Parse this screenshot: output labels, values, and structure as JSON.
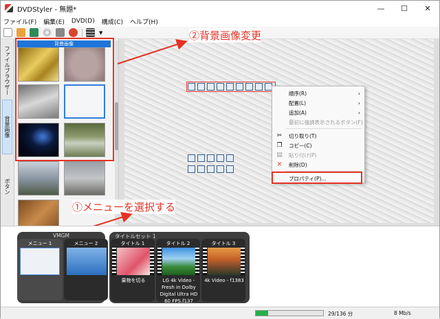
{
  "window": {
    "title": "DVDStyler - 無題*",
    "minimize": "—",
    "maximize": "☐",
    "close": "✕"
  },
  "menubar": [
    "ファイル(F)",
    "編集(E)",
    "DVD(D)",
    "構成(C)",
    "ヘルプ(H)"
  ],
  "side_tabs": [
    "ファイルブラウザー",
    "背景画像",
    "ボタン"
  ],
  "panel": {
    "header": "背景画像"
  },
  "canvas": {
    "button_row_1_count": 9,
    "button_row_2_count": 5,
    "button_row_3_count": 5
  },
  "context_menu": {
    "items": [
      {
        "label": "順序(R)",
        "submenu": true,
        "disabled": false
      },
      {
        "label": "配置(L)",
        "submenu": true,
        "disabled": false
      },
      {
        "label": "追加(A)",
        "submenu": true,
        "disabled": false
      },
      {
        "label": "最初に強調表示されるボタン(F)",
        "submenu": false,
        "disabled": true
      },
      {
        "label": "切り取り(T)",
        "icon": "cut-icon",
        "disabled": false
      },
      {
        "label": "コピー(C)",
        "icon": "copy-icon",
        "disabled": false
      },
      {
        "label": "貼り付け(P)",
        "icon": "paste-icon",
        "disabled": true
      },
      {
        "label": "削除(D)",
        "icon": "delete-icon",
        "disabled": false
      },
      {
        "label": "プロパティ(P)...",
        "disabled": false
      }
    ]
  },
  "annotations": {
    "step1": "①メニューを選択する",
    "step2": "②背景画像変更",
    "color": "#e53224"
  },
  "bottom": {
    "vmgm": {
      "label": "VMGM",
      "items": [
        {
          "label": "メニュー 1"
        },
        {
          "label": "メニュー 2"
        }
      ]
    },
    "titleset": {
      "label": "タイトルセット 1",
      "items": [
        {
          "label": "タイトル 1",
          "caption": "果物を切る"
        },
        {
          "label": "タイトル 2",
          "caption": "LG 4k Video - Fresh in Dolby Digital Ultra HD 60 FPS.f137"
        },
        {
          "label": "タイトル 3",
          "caption": "4k Video - f1383"
        }
      ]
    }
  },
  "status": {
    "progress_fraction": 0.18,
    "size": "29/136 分",
    "rate": "8 Mb/s"
  }
}
